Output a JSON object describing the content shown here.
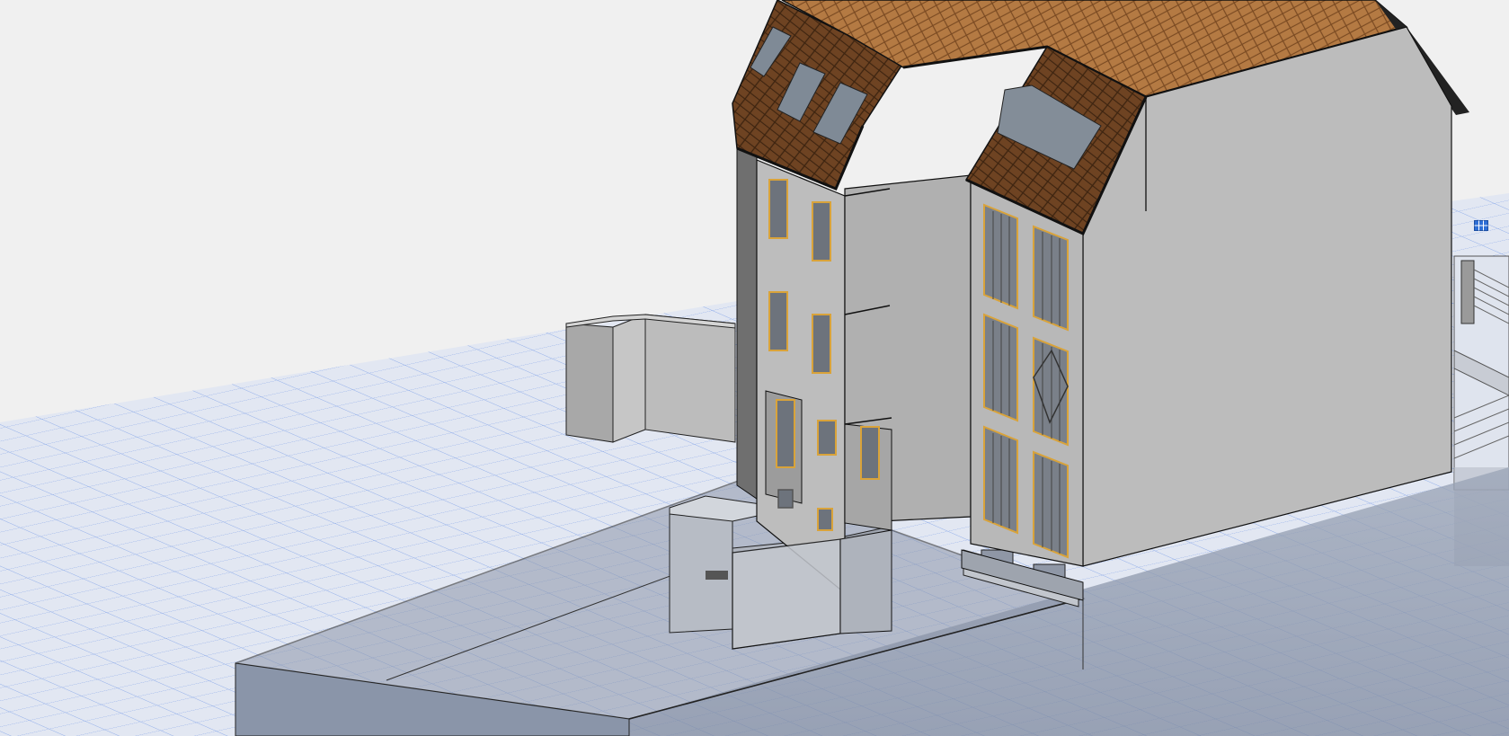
{
  "viewport": {
    "background": "#f0f0f0",
    "grid_color": "#8aa6e6",
    "grid_fill": "#e1e7f3",
    "wall_light": "#c0c0c0",
    "wall_mid": "#a4a4a4",
    "wall_dark": "#8c8c8c",
    "roof_front": "#8a5a2c",
    "roof_top": "#b87d45",
    "roof_dark": "#4a2e16",
    "window_frame": "#d9a33a",
    "basement_tint": "#7d889e"
  },
  "widgets": {
    "view_cube_icon": "grid-view-icon"
  }
}
